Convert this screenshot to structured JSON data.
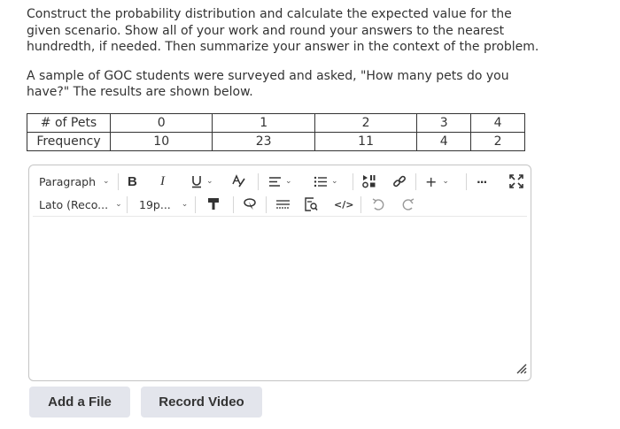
{
  "prompt": {
    "paragraph1": "Construct the probability distribution and calculate the expected value for the given scenario. Show all of your work and round your answers to the nearest hundredth, if needed. Then summarize your answer in the context of the problem.",
    "paragraph2": "A sample of GOC students were surveyed and asked, \"How many pets do you have?\" The results are shown below."
  },
  "table": {
    "header_label": "# of Pets",
    "frequency_label": "Frequency",
    "pets": [
      "0",
      "1",
      "2",
      "3",
      "4"
    ],
    "frequency": [
      "10",
      "23",
      "11",
      "4",
      "2"
    ]
  },
  "toolbar": {
    "paragraph_style": "Paragraph",
    "font_family": "Lato (Reco...",
    "font_size": "19p...",
    "bold": "B",
    "italic": "I",
    "insert": "+",
    "more": "···",
    "code": "</>"
  },
  "buttons": {
    "add_file": "Add a File",
    "record_video": "Record Video"
  },
  "icons": [
    "chevron-down-icon",
    "underline-icon",
    "text-color-icon",
    "align-icon",
    "list-icon",
    "insert-stuff-icon",
    "link-icon",
    "fullscreen-icon",
    "format-painter-icon",
    "highlight-icon",
    "equation-icon",
    "find-replace-icon",
    "undo-icon",
    "redo-icon",
    "resize-icon"
  ]
}
